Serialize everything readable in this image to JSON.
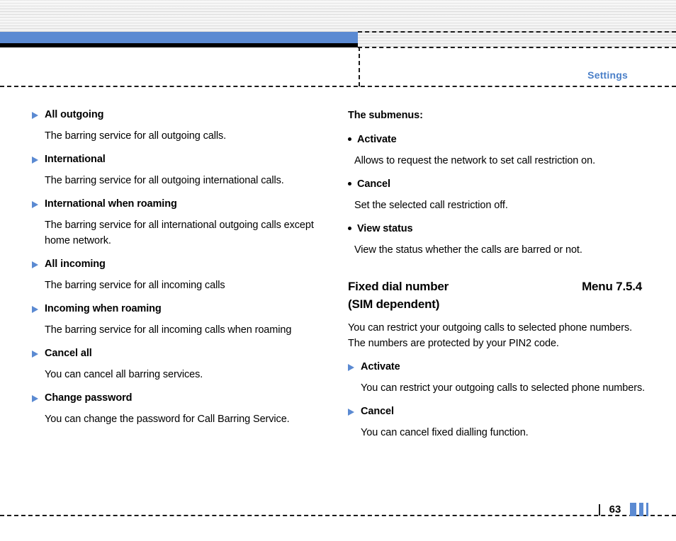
{
  "page": {
    "running_head": "Settings",
    "page_number": "63",
    "accent_color": "#5b8ad2",
    "text_color": "#000000"
  },
  "icons": {
    "triangle_bullet": "triangle-right-bullet",
    "dot_bullet": "dot-bullet",
    "footer_bars": "footer-bar-decoration"
  },
  "left_column": {
    "entries": [
      {
        "heading": "All outgoing",
        "body": "The barring service for all outgoing calls."
      },
      {
        "heading": "International",
        "body": "The barring service for all outgoing international calls."
      },
      {
        "heading": "International when roaming",
        "body": "The barring service for all international outgoing calls except home network."
      },
      {
        "heading": "All incoming",
        "body": "The barring service for all incoming calls"
      },
      {
        "heading": "Incoming when roaming",
        "body": "The barring service for all incoming calls when roaming"
      },
      {
        "heading": "Cancel all",
        "body": "You can cancel all barring services."
      },
      {
        "heading": "Change password",
        "body": "You can change the password for Call Barring Service."
      }
    ]
  },
  "right_column": {
    "submenus_label": "The submenus:",
    "submenu_entries": [
      {
        "heading": "Activate",
        "body": "Allows to request the network to set call restriction on."
      },
      {
        "heading": "Cancel",
        "body": "Set the selected call restriction off."
      },
      {
        "heading": "View status",
        "body": "View the status whether the calls are barred or not."
      }
    ],
    "section": {
      "title": "Fixed dial number",
      "subtitle": "(SIM dependent)",
      "menu_code": "Menu 7.5.4",
      "intro": "You can restrict your outgoing calls to selected phone numbers. The numbers are protected by your PIN2 code.",
      "entries": [
        {
          "heading": "Activate",
          "body": "You can restrict your outgoing calls to selected phone numbers."
        },
        {
          "heading": "Cancel",
          "body": "You can cancel fixed dialling function."
        }
      ]
    }
  }
}
